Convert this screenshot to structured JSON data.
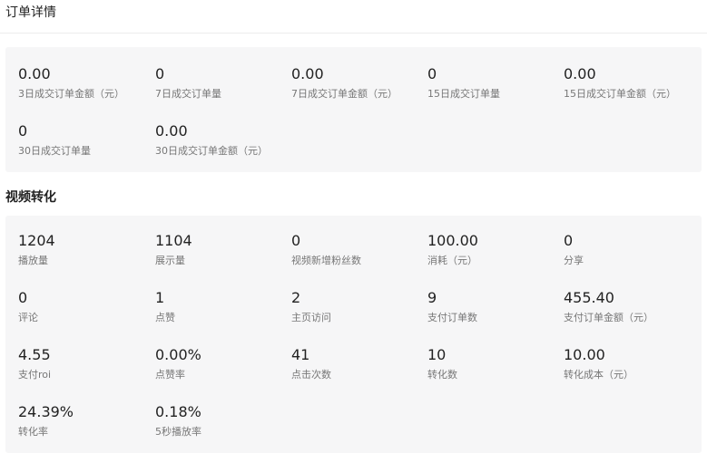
{
  "order_section": {
    "title": "订单详情",
    "metrics": [
      {
        "value": "0.00",
        "label": "3日成交订单金额（元）"
      },
      {
        "value": "0",
        "label": "7日成交订单量"
      },
      {
        "value": "0.00",
        "label": "7日成交订单金额（元）"
      },
      {
        "value": "0",
        "label": "15日成交订单量"
      },
      {
        "value": "0.00",
        "label": "15日成交订单金额（元）"
      },
      {
        "value": "0",
        "label": "30日成交订单量"
      },
      {
        "value": "0.00",
        "label": "30日成交订单金额（元）"
      }
    ]
  },
  "video_section": {
    "title": "视频转化",
    "metrics": [
      {
        "value": "1204",
        "label": "播放量"
      },
      {
        "value": "1104",
        "label": "展示量"
      },
      {
        "value": "0",
        "label": "视频新增粉丝数"
      },
      {
        "value": "100.00",
        "label": "消耗（元）"
      },
      {
        "value": "0",
        "label": "分享"
      },
      {
        "value": "0",
        "label": "评论"
      },
      {
        "value": "1",
        "label": "点赞"
      },
      {
        "value": "2",
        "label": "主页访问"
      },
      {
        "value": "9",
        "label": "支付订单数"
      },
      {
        "value": "455.40",
        "label": "支付订单金额（元）"
      },
      {
        "value": "4.55",
        "label": "支付roi"
      },
      {
        "value": "0.00%",
        "label": "点赞率"
      },
      {
        "value": "41",
        "label": "点击次数"
      },
      {
        "value": "10",
        "label": "转化数"
      },
      {
        "value": "10.00",
        "label": "转化成本（元）"
      },
      {
        "value": "24.39%",
        "label": "转化率"
      },
      {
        "value": "0.18%",
        "label": "5秒播放率"
      }
    ]
  }
}
